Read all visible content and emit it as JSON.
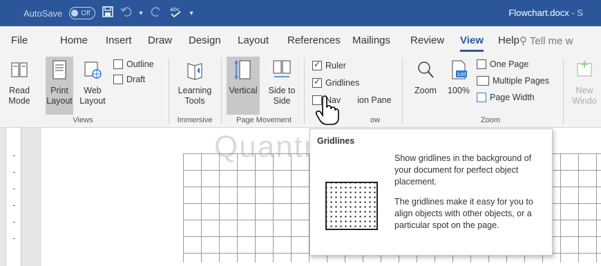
{
  "titlebar": {
    "autosave_label": "AutoSave",
    "autosave_state": "Off",
    "doc_title": "Flowchart.docx",
    "doc_title_suffix": "- S",
    "brand_color": "#2b579a",
    "icons": [
      "save-icon",
      "undo-icon",
      "redo-icon",
      "spelling-icon",
      "customize-qat-icon"
    ]
  },
  "tabs": [
    {
      "label": "File"
    },
    {
      "label": "Home"
    },
    {
      "label": "Insert"
    },
    {
      "label": "Draw"
    },
    {
      "label": "Design"
    },
    {
      "label": "Layout"
    },
    {
      "label": "References"
    },
    {
      "label": "Mailings"
    },
    {
      "label": "Review"
    },
    {
      "label": "View",
      "active": true
    },
    {
      "label": "Help"
    }
  ],
  "tell_me": "Tell me w",
  "ribbon": {
    "views": {
      "group": "Views",
      "read_mode": "Read Mode",
      "print_layout": "Print Layout",
      "web_layout": "Web Layout",
      "outline": "Outline",
      "draft": "Draft"
    },
    "immersive": {
      "group": "Immersive",
      "learning_tools": "Learning Tools"
    },
    "page_movement": {
      "group": "Page Movement",
      "vertical": "Vertical",
      "side_to_side": "Side to Side"
    },
    "show": {
      "group": "ow",
      "ruler": {
        "label": "Ruler",
        "checked": true
      },
      "gridlines": {
        "label": "Gridlines",
        "checked": true
      },
      "navigation_pane": {
        "label_start": "Nav",
        "label_end": "ion Pane",
        "checked": false
      }
    },
    "zoom": {
      "group": "Zoom",
      "zoom": "Zoom",
      "hundred": "100%",
      "hundred_badge": "100",
      "one_page": "One Page",
      "multiple_pages": "Multiple Pages",
      "page_width": "Page Width"
    },
    "window": {
      "new_window": "New Windo"
    }
  },
  "tooltip": {
    "title": "Gridlines",
    "desc1": "Show gridlines in the background of your document for perfect object placement.",
    "desc2": "The gridlines make it easy for you to align objects with other objects, or a particular spot on the page."
  },
  "watermark": "Quantrimang"
}
